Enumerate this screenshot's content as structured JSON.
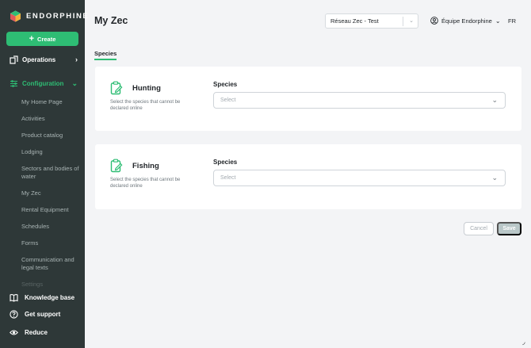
{
  "brand": {
    "name": "ENDORPHINE",
    "accent": "#2ebd74",
    "sidebar_bg": "#2e3838"
  },
  "sidebar": {
    "create_label": "Create",
    "operations_label": "Operations",
    "configuration_label": "Configuration",
    "sub_items": [
      "My Home Page",
      "Activities",
      "Product catalog",
      "Lodging",
      "Sectors and bodies of water",
      "My Zec",
      "Rental Equipment",
      "Schedules",
      "Forms",
      "Communication and legal texts",
      "Settings"
    ],
    "knowledge_base": "Knowledge base",
    "get_support": "Get support",
    "reduce": "Reduce"
  },
  "header": {
    "title": "My Zec",
    "network_select_value": "Réseau Zec - Test",
    "team": "Équipe Endorphine",
    "language": "FR"
  },
  "tabs": {
    "active": "Species"
  },
  "cards": [
    {
      "title": "Hunting",
      "description": "Select the species that cannot be declared online",
      "field_label": "Species",
      "placeholder": "Select"
    },
    {
      "title": "Fishing",
      "description": "Select the species that cannot be declared online",
      "field_label": "Species",
      "placeholder": "Select"
    }
  ],
  "actions": {
    "cancel": "Cancel",
    "save": "Save"
  }
}
